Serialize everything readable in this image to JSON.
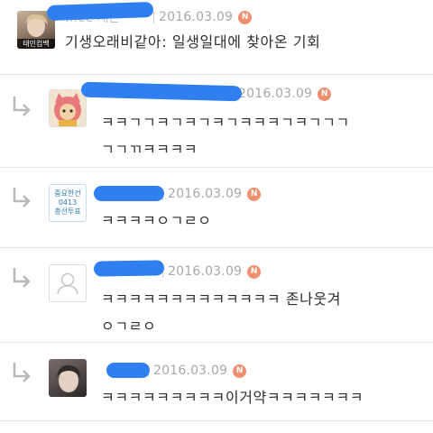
{
  "comments": [
    {
      "author_visible": "…ee 재은",
      "date": "2016.03.09",
      "badge": "N",
      "avatar_label": "태민컴백",
      "text": "기생오래비같아: 일생일대에 찾아온 기회"
    },
    {
      "author_visible": "",
      "date": "2016.03.09",
      "badge": "N",
      "text": "ㅋㅋㄱㄱㅋㄱㅋㄱㅋㄱㅋㅋㅋㄱㅋㄱㄱㄱ\nㄱㄱㄲㅋㅋㅋㅋ"
    },
    {
      "author_visible": "",
      "date": "2016.03.09",
      "badge": "N",
      "avatar_lines": [
        "중요한건",
        "0413",
        "총선투표"
      ],
      "text": "ㅋㅋㅋㅋㅇㄱㄹㅇ"
    },
    {
      "author_visible": "…",
      "date": "2016.03.09",
      "badge": "N",
      "text": "ㅋㅋㅋㅋㅋㅋㅋㅋㅋㅋㅋㅋㅋ 존나웃겨\nㅇㄱㄹㅇ"
    },
    {
      "author_visible": "",
      "date": "2016.03.09",
      "badge": "N",
      "text": "ㅋㅋㅋㅋㅋㅋㅋㅋㅋ이거약ㅋㅋㅋㅋㅋㅋㅋ"
    }
  ],
  "colors": {
    "redaction": "#2f7ff0",
    "badge": "#ee8f6f",
    "arrow": "#b8b8b8",
    "divider": "#e4e4e4"
  },
  "icons": {
    "reply": "reply-arrow-icon",
    "default_avatar": "person-silhouette-icon"
  }
}
